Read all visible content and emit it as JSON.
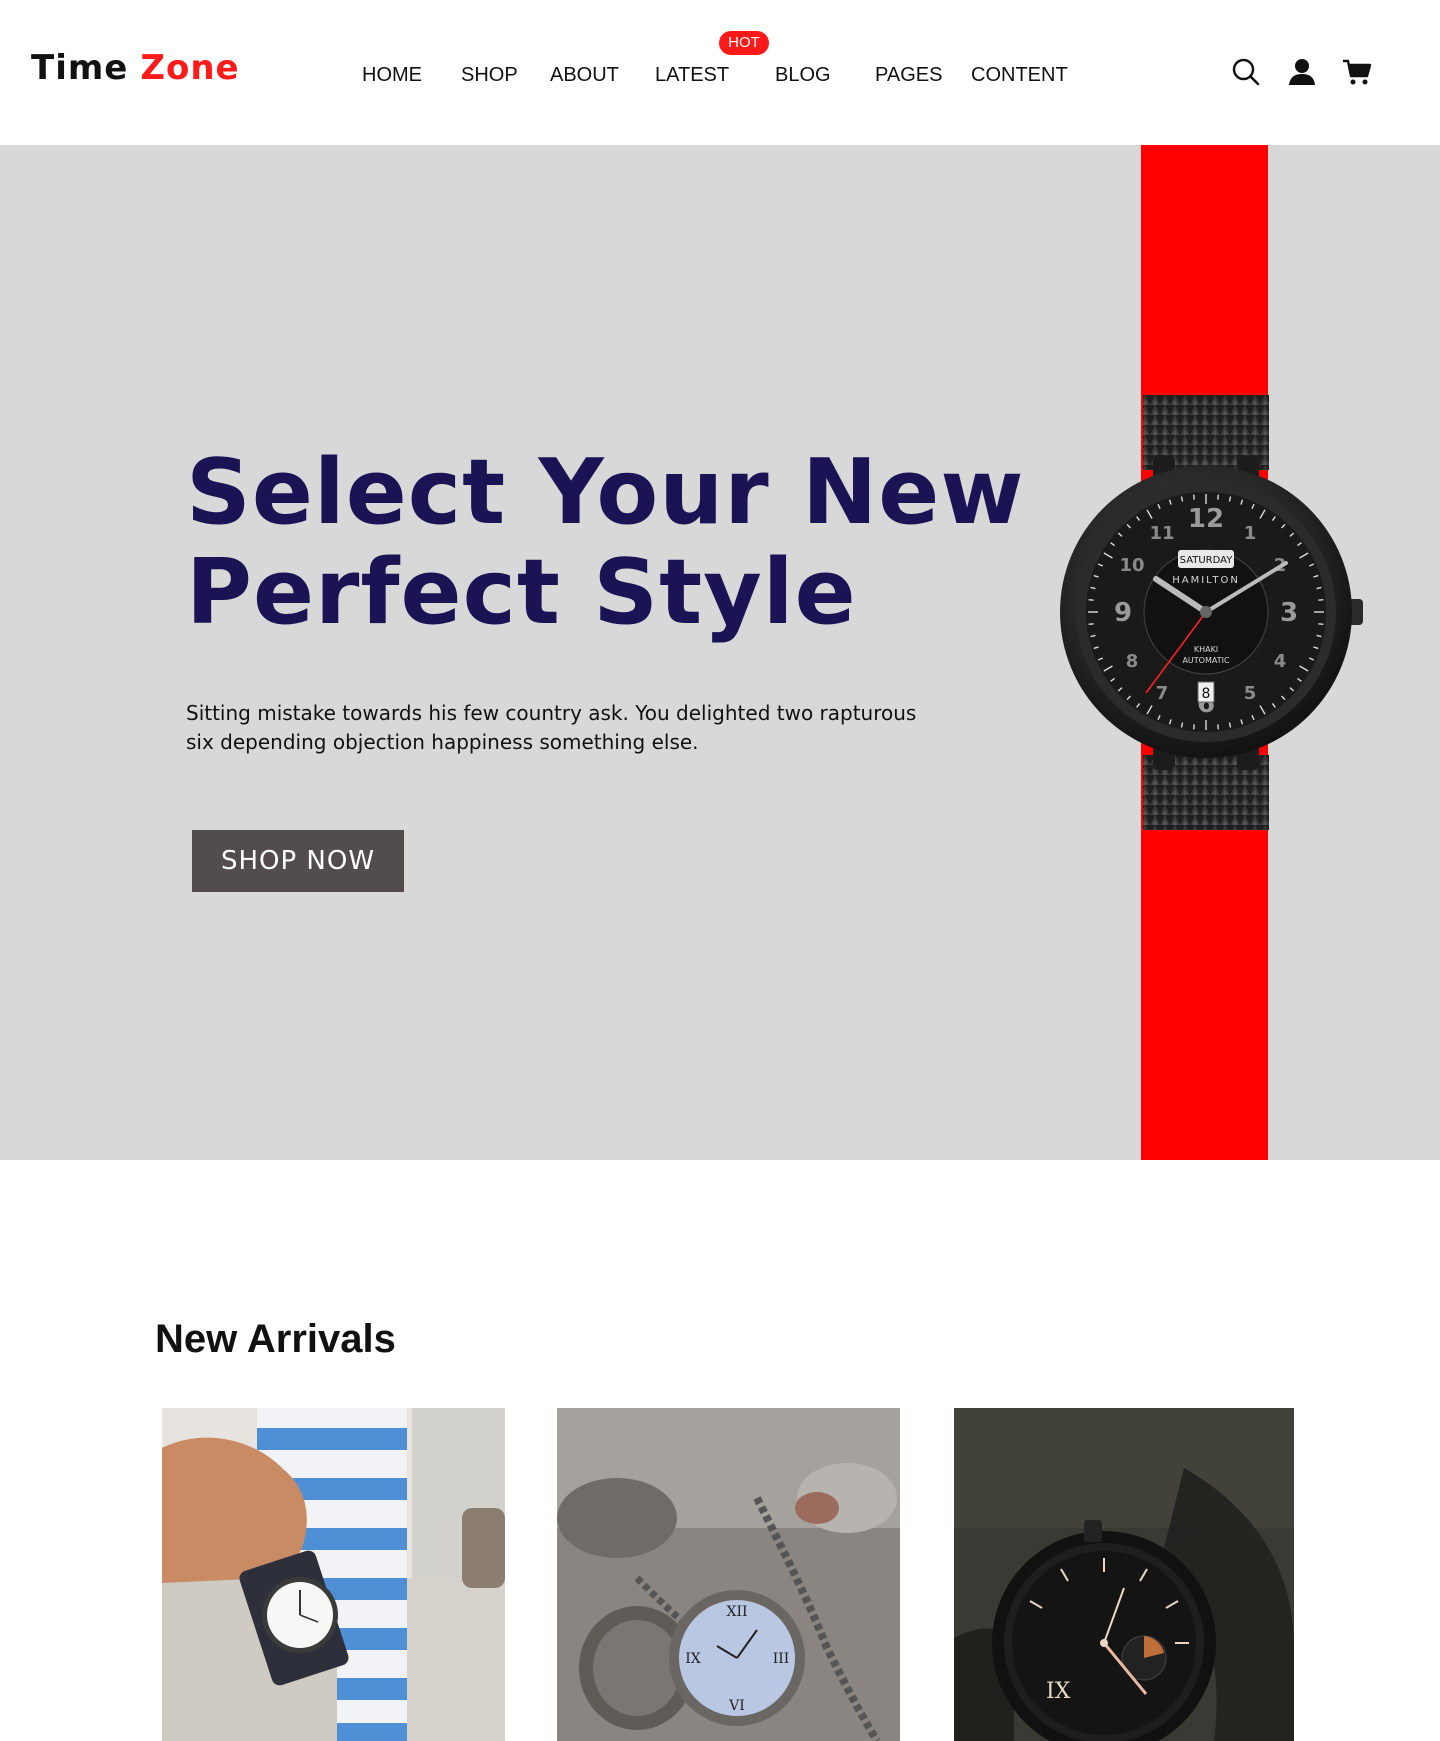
{
  "brand": {
    "part1": "Time",
    "part2": "Zone"
  },
  "nav": {
    "items": [
      {
        "label": "HOME"
      },
      {
        "label": "SHOP"
      },
      {
        "label": "ABOUT"
      },
      {
        "label": "LATEST"
      },
      {
        "label": "BLOG"
      },
      {
        "label": "PAGES"
      },
      {
        "label": "CONTENT"
      }
    ],
    "badge": "HOT"
  },
  "header_icons": [
    "search-icon",
    "user-icon",
    "cart-icon"
  ],
  "hero": {
    "title_line1": "Select Your New",
    "title_line2": "Perfect Style",
    "description": "Sitting mistake towards his few country ask. You delighted two rapturous six depending objection happiness something else.",
    "button_label": "SHOP NOW",
    "watch_dial": {
      "day": "SATURDAY",
      "brand": "HAMILTON",
      "line1": "KHAKI",
      "line2": "AUTOMATIC",
      "date": "8"
    }
  },
  "new_arrivals": {
    "title": "New Arrivals"
  },
  "colors": {
    "accent": "#ff1a1a",
    "hero_bg": "#d9d8d9",
    "title": "#1b1454",
    "button": "#524c4d"
  }
}
